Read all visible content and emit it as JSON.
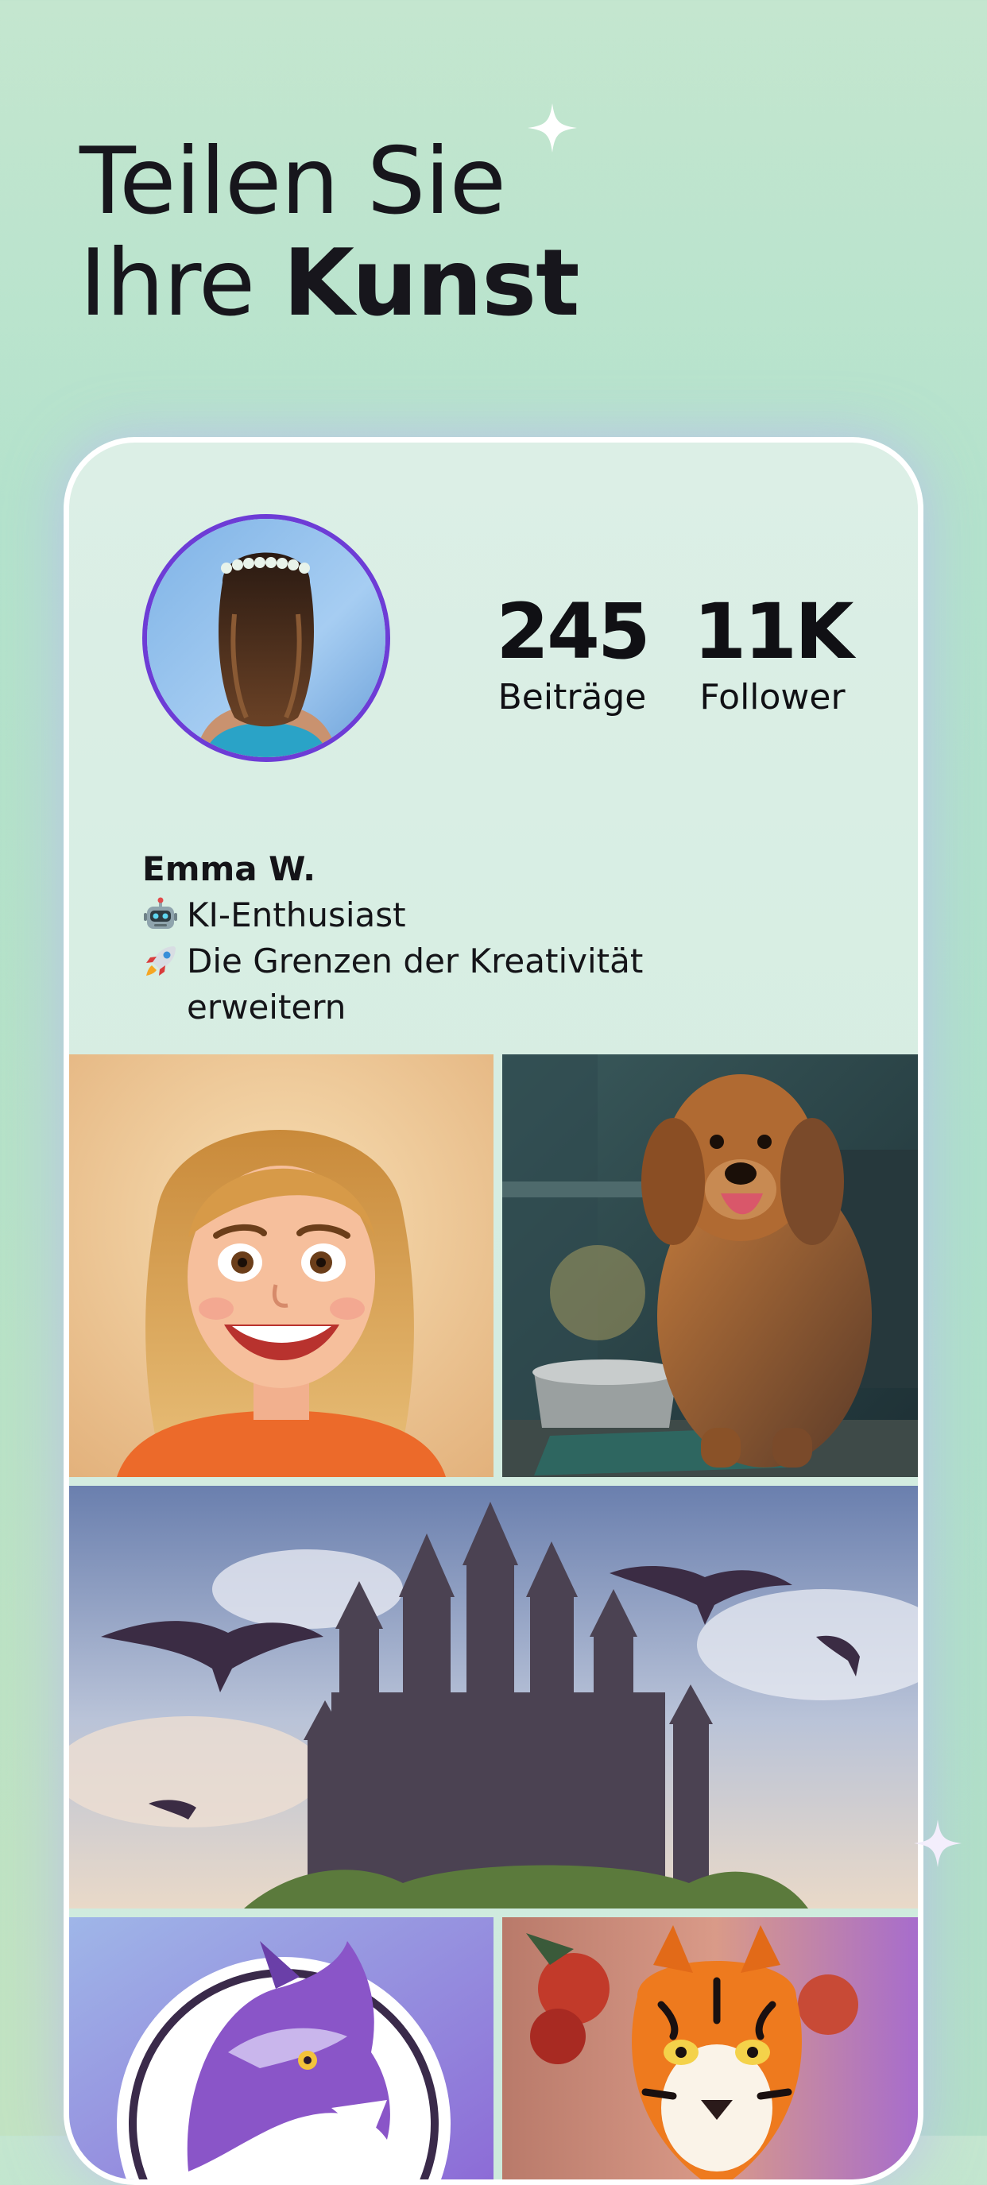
{
  "headline": {
    "line1": "Teilen Sie",
    "line2_regular": "Ihre",
    "line2_bold": "Kunst"
  },
  "profile": {
    "posts_value": "245",
    "posts_label": "Beiträge",
    "followers_value": "11K",
    "followers_label": "Follower",
    "name": "Emma W.",
    "bio_line1": "KI-Enthusiast",
    "bio_line2": "Die Grenzen der Kreativität erweitern",
    "bio_line1_icon": "robot-emoji",
    "bio_line2_icon": "rocket-emoji"
  },
  "gallery": [
    {
      "subject": "cartoon-woman-portrait"
    },
    {
      "subject": "golden-retriever-in-kitchen"
    },
    {
      "subject": "fantasy-castle-with-dragons"
    },
    {
      "subject": "purple-wolf-logo"
    },
    {
      "subject": "tiger-back-tattoo"
    }
  ],
  "colors": {
    "accent": "#6d3cd6",
    "background": "#b3e2cc",
    "card": "#d6eee2",
    "text": "#17161c"
  }
}
